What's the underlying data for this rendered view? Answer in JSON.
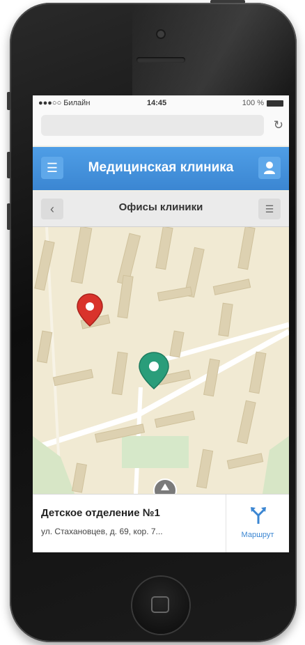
{
  "status": {
    "carrier": "●●●○○ Билайн",
    "time": "14:45",
    "battery": "100 %"
  },
  "browser": {
    "url": "",
    "reload_icon": "reload-icon"
  },
  "header": {
    "title": "Медицинская клиника",
    "menu_icon": "menu-icon",
    "profile_icon": "user-icon"
  },
  "subheader": {
    "title": "Офисы клиники",
    "back_icon": "chevron-left-icon",
    "list_icon": "list-icon"
  },
  "map": {
    "markers": [
      {
        "color": "#d9332b",
        "name": "clinic-marker-red"
      },
      {
        "color": "#2a9d7a",
        "name": "clinic-marker-green"
      }
    ]
  },
  "office": {
    "name": "Детское отделение №1",
    "address": "ул. Стахановцев, д. 69, кор. 7..."
  },
  "route": {
    "label": "Маршрут",
    "icon": "route-fork-icon"
  },
  "colors": {
    "accent": "#3b86d2",
    "map_bg": "#f1ead3"
  }
}
